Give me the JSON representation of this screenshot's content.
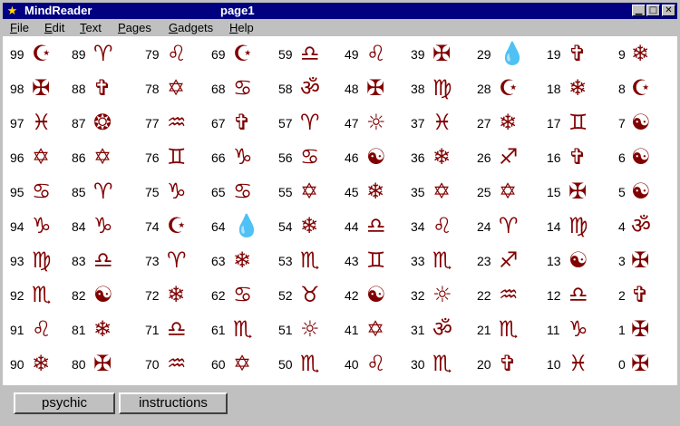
{
  "window": {
    "app_title": "MindReader",
    "page_title": "page1",
    "app_icon": "★"
  },
  "title_buttons": {
    "minimize": "▁",
    "maximize": "□",
    "close": "✕"
  },
  "menu": [
    "File",
    "Edit",
    "Text",
    "Pages",
    "Gadgets",
    "Help"
  ],
  "columns": [
    [
      "99",
      "☪",
      "98",
      "✠",
      "97",
      "♓",
      "96",
      "✡",
      "95",
      "♋",
      "94",
      "♑",
      "93",
      "♍",
      "92",
      "♏",
      "91",
      "♌",
      "90",
      "❄"
    ],
    [
      "89",
      "♈",
      "88",
      "✞",
      "87",
      "❂",
      "86",
      "✡",
      "85",
      "♈",
      "84",
      "♑",
      "83",
      "♎",
      "82",
      "☯",
      "81",
      "❄",
      "80",
      "✠"
    ],
    [
      "79",
      "♌",
      "78",
      "✡",
      "77",
      "♒",
      "76",
      "♊",
      "75",
      "♑",
      "74",
      "☪",
      "73",
      "♈",
      "72",
      "❄",
      "71",
      "♎",
      "70",
      "♒"
    ],
    [
      "69",
      "☪",
      "68",
      "♋",
      "67",
      "✞",
      "66",
      "♑",
      "65",
      "♋",
      "64",
      "💧",
      "63",
      "❄",
      "62",
      "♋",
      "61",
      "♏",
      "60",
      "✡"
    ],
    [
      "59",
      "♎",
      "58",
      "ॐ",
      "57",
      "♈",
      "56",
      "♋",
      "55",
      "✡",
      "54",
      "❄",
      "53",
      "♏",
      "52",
      "♉",
      "51",
      "☼",
      "50",
      "♏"
    ],
    [
      "49",
      "♌",
      "48",
      "✠",
      "47",
      "☼",
      "46",
      "☯",
      "45",
      "❄",
      "44",
      "♎",
      "43",
      "♊",
      "42",
      "☯",
      "41",
      "✡",
      "40",
      "♌"
    ],
    [
      "39",
      "✠",
      "38",
      "♍",
      "37",
      "♓",
      "36",
      "❄",
      "35",
      "✡",
      "34",
      "♌",
      "33",
      "♏",
      "32",
      "☼",
      "31",
      "ॐ",
      "30",
      "♏"
    ],
    [
      "29",
      "💧",
      "28",
      "☪",
      "27",
      "❄",
      "26",
      "♐",
      "25",
      "✡",
      "24",
      "♈",
      "23",
      "♐",
      "22",
      "♒",
      "21",
      "♏",
      "20",
      "✞"
    ],
    [
      "19",
      "✞",
      "18",
      "❄",
      "17",
      "♊",
      "16",
      "✞",
      "15",
      "✠",
      "14",
      "♍",
      "13",
      "☯",
      "12",
      "♎",
      "11",
      "♑",
      "10",
      "♓"
    ],
    [
      "9",
      "❄",
      "8",
      "☪",
      "7",
      "☯",
      "6",
      "☯",
      "5",
      "☯",
      "4",
      "ॐ",
      "3",
      "✠",
      "2",
      "✞",
      "1",
      "✠",
      "0",
      "✠"
    ]
  ],
  "buttons": {
    "psychic": "psychic",
    "instructions": "instructions"
  }
}
